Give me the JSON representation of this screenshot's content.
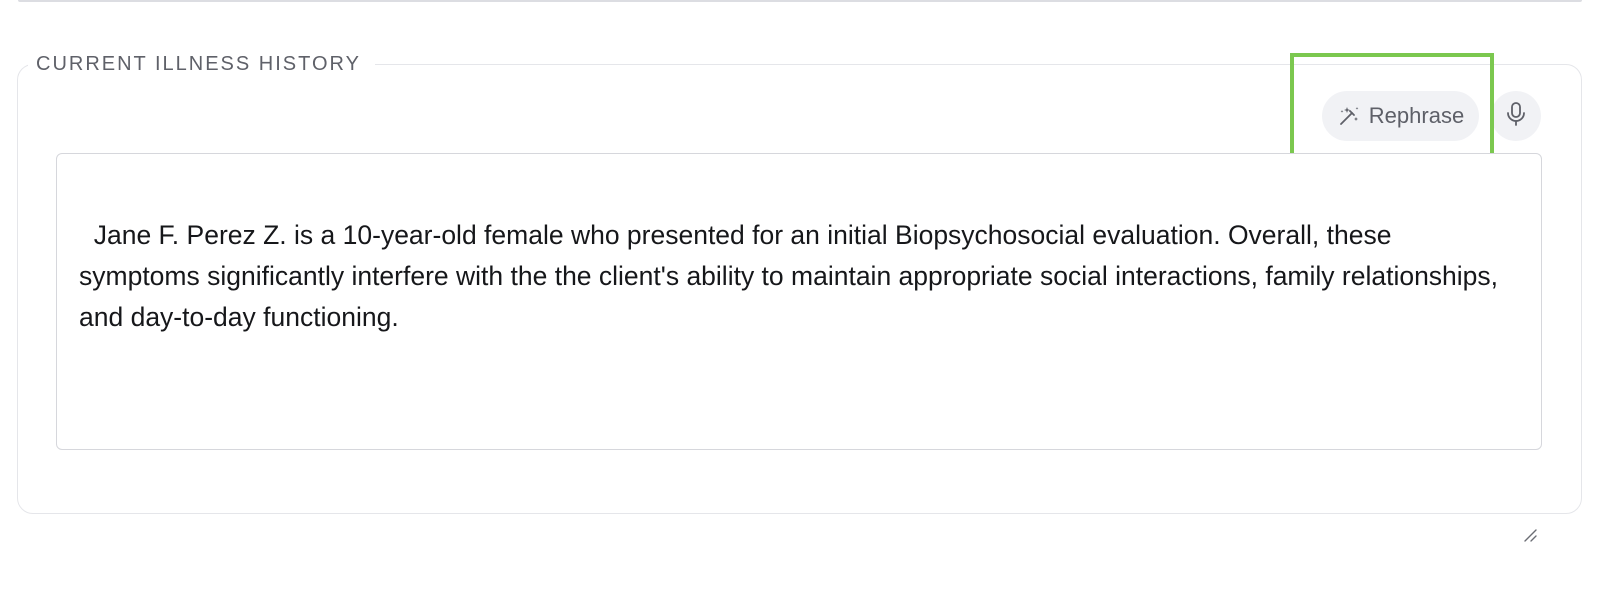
{
  "section": {
    "title": "CURRENT ILLNESS HISTORY"
  },
  "toolbar": {
    "rephrase_label": "Rephrase",
    "rephrase_icon": "magic-wand-icon",
    "mic_icon": "microphone-icon"
  },
  "textarea": {
    "value": "Jane F. Perez Z. is a 10-year-old female who presented for an initial Biopsychosocial evaluation. Overall, these symptoms significantly interfere with the the client's ability to maintain appropriate social interactions, family relationships, and day-to-day functioning."
  },
  "colors": {
    "highlight": "#7bc84f",
    "button_bg": "#f1f2f5",
    "text": "#16171a",
    "legend": "#5f6169"
  }
}
